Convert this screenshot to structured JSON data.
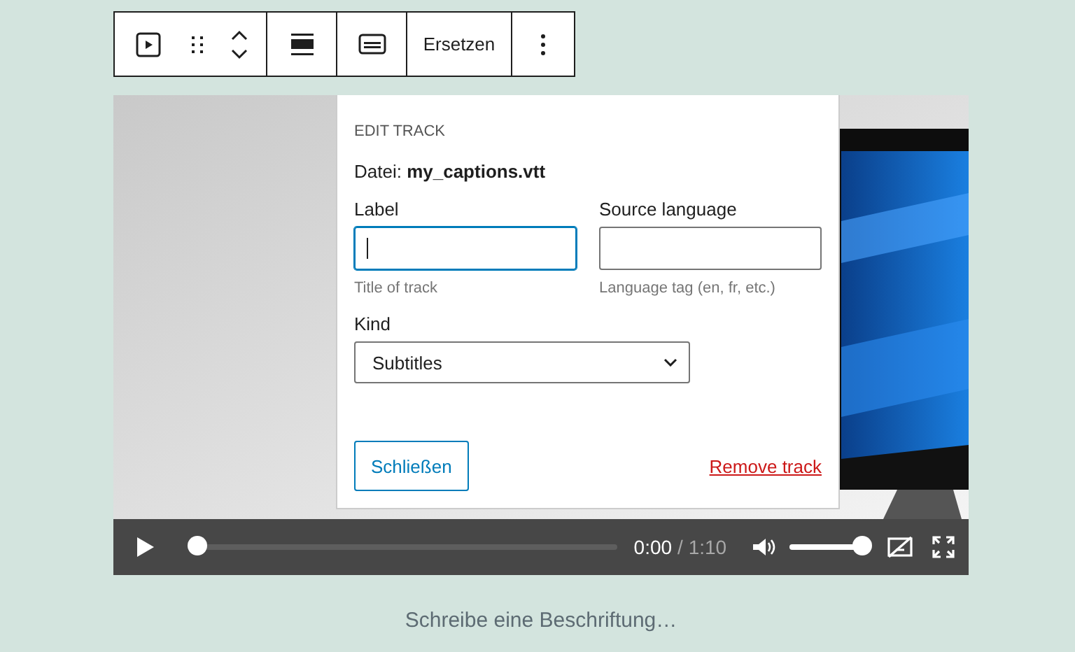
{
  "toolbar": {
    "replace_button": "Ersetzen"
  },
  "video": {
    "progress": {
      "level": 0.0
    },
    "current_time": "0:00",
    "duration": "/ 1:10",
    "volume": {
      "level": 1.0
    },
    "captions_on": false
  },
  "edit_track": {
    "heading": "EDIT TRACK",
    "file_label": "Datei:",
    "file_name": "my_captions.vtt",
    "fields": [
      {
        "label": "Label",
        "help": "Title of track",
        "focused": true
      },
      {
        "label": "Source language",
        "help": "Language tag (en, fr, etc.)",
        "focused": false
      }
    ],
    "kind": {
      "label": "Kind",
      "value": "Subtitles"
    },
    "close_button": "Schließen",
    "remove_link": "Remove track"
  },
  "caption": {
    "placeholder": "Schreibe eine Beschriftung…"
  }
}
